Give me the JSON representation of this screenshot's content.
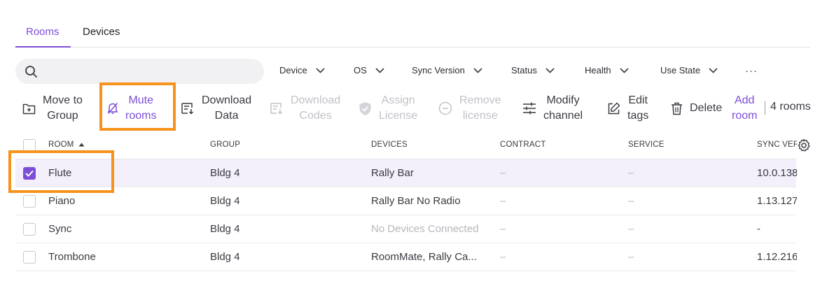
{
  "tabs": {
    "rooms": "Rooms",
    "devices": "Devices"
  },
  "search": {
    "placeholder": ""
  },
  "filters": {
    "device": "Device",
    "os": "OS",
    "sync_version": "Sync Version",
    "status": "Status",
    "health": "Health",
    "use_state": "Use State",
    "more": "···"
  },
  "toolbar": {
    "move_to_group": [
      "Move to",
      "Group"
    ],
    "mute_rooms": [
      "Mute",
      "rooms"
    ],
    "download_data": [
      "Download",
      "Data"
    ],
    "download_codes": [
      "Download",
      "Codes"
    ],
    "assign_license": [
      "Assign",
      "License"
    ],
    "remove_license": [
      "Remove",
      "license"
    ],
    "modify_channel": [
      "Modify",
      "channel"
    ],
    "edit_tags": [
      "Edit",
      "tags"
    ],
    "delete": "Delete",
    "add_room": [
      "Add",
      "room"
    ],
    "count": "4 rooms"
  },
  "table": {
    "headers": {
      "room": "ROOM",
      "group": "GROUP",
      "devices": "DEVICES",
      "contract": "CONTRACT",
      "service": "SERVICE",
      "sync_version": "SYNC VER"
    },
    "rows": [
      {
        "room": "Flute",
        "group": "Bldg 4",
        "devices": "Rally Bar",
        "contract": "–",
        "service": "–",
        "sync": "10.0.138",
        "selected": true
      },
      {
        "room": "Piano",
        "group": "Bldg 4",
        "devices": "Rally Bar No Radio",
        "contract": "–",
        "service": "–",
        "sync": "1.13.127",
        "selected": false
      },
      {
        "room": "Sync",
        "group": "Bldg 4",
        "devices": "No Devices Connected",
        "contract": "–",
        "service": "–",
        "sync": "-",
        "selected": false
      },
      {
        "room": "Trombone",
        "group": "Bldg 4",
        "devices": "RoomMate, Rally Ca...",
        "contract": "–",
        "service": "–",
        "sync": "1.12.216",
        "selected": false
      }
    ]
  },
  "colors": {
    "accent": "#7d4ed8",
    "highlight": "#f5931d"
  }
}
